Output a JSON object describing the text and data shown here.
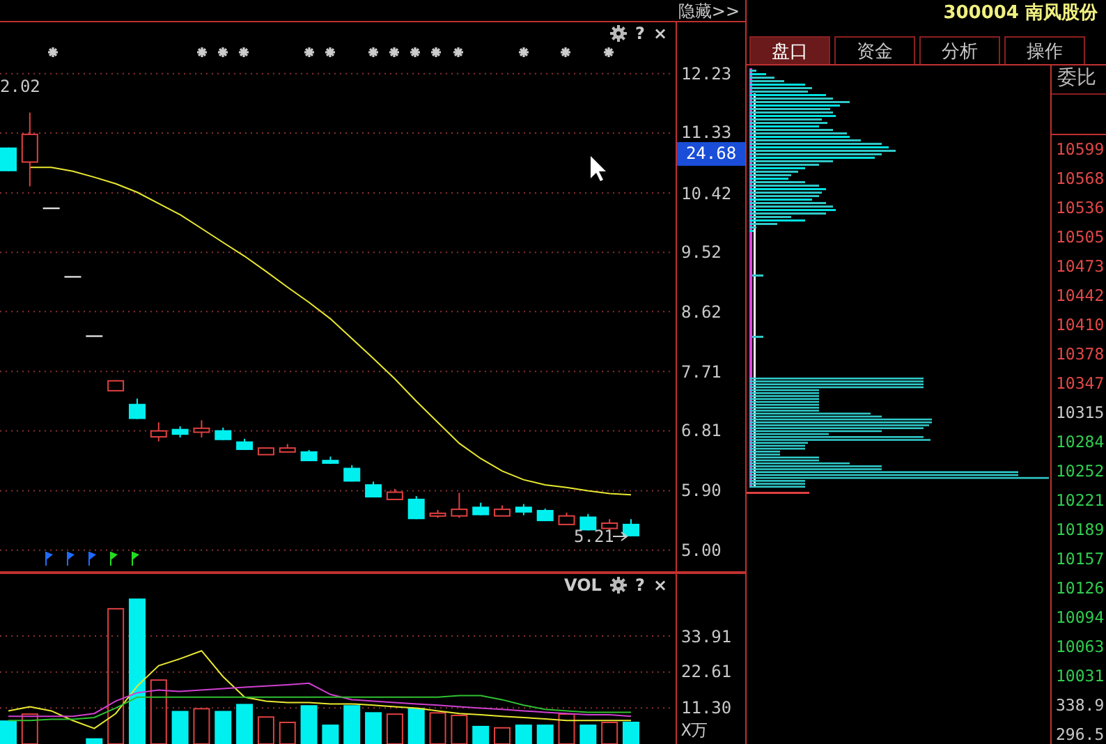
{
  "toolbar": {
    "hide_button": "隐藏>>"
  },
  "price_chart": {
    "help_icon": "?",
    "close_icon": "×",
    "high_label": "2.02",
    "last_label": "5.21",
    "current_price": "24.68",
    "chart_data": {
      "type": "candlestick",
      "ylim": [
        4.68,
        13.01
      ],
      "grid": true,
      "series": [
        {
          "type": "line",
          "color": "#e8e830",
          "values": [
            null,
            10.81,
            10.81,
            10.75,
            10.66,
            10.56,
            10.43,
            10.26,
            10.09,
            9.88,
            9.67,
            9.46,
            9.23,
            8.99,
            8.76,
            8.51,
            8.21,
            7.91,
            7.6,
            7.26,
            6.94,
            6.62,
            6.39,
            6.2,
            6.07,
            5.99,
            5.95,
            5.9,
            5.86,
            5.84
          ]
        }
      ],
      "yticks": [
        {
          "value": 12.23,
          "label": "12.23"
        },
        {
          "value": 11.33,
          "label": "11.33"
        },
        {
          "value": 10.42,
          "label": "10.42"
        },
        {
          "value": 9.52,
          "label": "9.52"
        },
        {
          "value": 8.62,
          "label": "8.62"
        },
        {
          "value": 7.71,
          "label": "7.71"
        },
        {
          "value": 6.81,
          "label": "6.81"
        },
        {
          "value": 5.9,
          "label": "5.90"
        },
        {
          "value": 5.0,
          "label": "5.00"
        }
      ],
      "categories": [
        null,
        null,
        null,
        null,
        null,
        null,
        null,
        null,
        null,
        null,
        null,
        null,
        null,
        null,
        null,
        null,
        null,
        null,
        null,
        null,
        null,
        null,
        null,
        null,
        null,
        null,
        null,
        null,
        null,
        null
      ],
      "ohlc": [
        [
          11.11,
          11.11,
          10.75,
          10.75
        ],
        [
          10.9,
          11.64,
          10.52,
          11.32
        ],
        [
          10.2,
          10.2,
          10.2,
          10.2
        ],
        [
          9.16,
          9.16,
          9.16,
          9.16
        ],
        [
          8.26,
          8.26,
          8.26,
          8.26
        ],
        [
          7.43,
          7.58,
          7.43,
          7.58
        ],
        [
          7.22,
          7.3,
          6.99,
          6.99
        ],
        [
          6.73,
          6.94,
          6.65,
          6.82
        ],
        [
          6.84,
          6.88,
          6.71,
          6.75
        ],
        [
          6.8,
          6.97,
          6.71,
          6.86
        ],
        [
          6.82,
          6.86,
          6.67,
          6.67
        ],
        [
          6.65,
          6.69,
          6.52,
          6.52
        ],
        [
          6.46,
          6.56,
          6.46,
          6.56
        ],
        [
          6.5,
          6.61,
          6.5,
          6.56
        ],
        [
          6.5,
          6.52,
          6.35,
          6.35
        ],
        [
          6.37,
          6.42,
          6.31,
          6.31
        ],
        [
          6.25,
          6.29,
          6.04,
          6.04
        ],
        [
          6.0,
          6.04,
          5.8,
          5.8
        ],
        [
          5.78,
          5.93,
          5.78,
          5.89
        ],
        [
          5.78,
          5.82,
          5.47,
          5.47
        ],
        [
          5.53,
          5.61,
          5.49,
          5.57
        ],
        [
          5.53,
          5.87,
          5.49,
          5.63
        ],
        [
          5.66,
          5.72,
          5.53,
          5.53
        ],
        [
          5.53,
          5.68,
          5.53,
          5.63
        ],
        [
          5.66,
          5.7,
          5.53,
          5.57
        ],
        [
          5.61,
          5.63,
          5.44,
          5.44
        ],
        [
          5.4,
          5.57,
          5.4,
          5.53
        ],
        [
          5.51,
          5.55,
          5.3,
          5.3
        ],
        [
          5.34,
          5.47,
          5.3,
          5.42
        ],
        [
          5.4,
          5.47,
          5.21,
          5.21
        ]
      ]
    },
    "flags": [
      {
        "color": "#1e6cff"
      },
      {
        "color": "#1e6cff"
      },
      {
        "color": "#1e6cff"
      },
      {
        "color": "#22dd22"
      },
      {
        "color": "#22dd22"
      }
    ]
  },
  "volume_chart": {
    "title": "VOL",
    "help_icon": "?",
    "close_icon": "×",
    "unit": "X万",
    "chart_data": {
      "type": "bar",
      "ylim": [
        0,
        53.4
      ],
      "grid": true,
      "yticks": [
        {
          "value": 33.91,
          "label": "33.91"
        },
        {
          "value": 22.61,
          "label": "22.61"
        },
        {
          "value": 11.3,
          "label": "11.30"
        }
      ],
      "categories": [
        null,
        null,
        null,
        null,
        null,
        null,
        null,
        null,
        null,
        null,
        null,
        null,
        null,
        null,
        null,
        null,
        null,
        null,
        null,
        null,
        null,
        null,
        null,
        null,
        null,
        null,
        null,
        null,
        null,
        null
      ],
      "series": [
        {
          "type": "bar",
          "color": "#00f0f0",
          "values": [
            7.4,
            null,
            null,
            null,
            1.8,
            null,
            45.7,
            null,
            10.4,
            null,
            10.4,
            12.6,
            null,
            null,
            12.2,
            6.1,
            12.2,
            10.0,
            null,
            11.3,
            null,
            null,
            5.7,
            null,
            6.1,
            6.1,
            null,
            6.1,
            null,
            7.0
          ]
        },
        {
          "type": "bar",
          "color": "#e04040",
          "values": [
            null,
            9.6,
            null,
            null,
            null,
            42.7,
            null,
            20.3,
            null,
            11.3,
            null,
            null,
            8.7,
            7.0,
            null,
            null,
            null,
            null,
            9.6,
            null,
            10.0,
            9.2,
            null,
            5.3,
            null,
            null,
            9.6,
            null,
            7.0,
            null
          ]
        },
        {
          "type": "line",
          "color": "#e8e830",
          "values": [
            10.4,
            11.7,
            10.4,
            7.4,
            4.9,
            9.6,
            18.2,
            24.6,
            26.8,
            29.3,
            21.2,
            14.7,
            13.5,
            13.0,
            13.0,
            12.6,
            12.6,
            12.2,
            11.7,
            11.3,
            10.4,
            9.6,
            9.2,
            8.7,
            8.3,
            7.9,
            7.4,
            7.4,
            7.4,
            7.4
          ]
        },
        {
          "type": "line",
          "color": "#d040d0",
          "values": [
            8.7,
            8.7,
            8.7,
            8.7,
            9.6,
            13.5,
            16.1,
            17.0,
            16.5,
            17.0,
            17.4,
            17.8,
            18.2,
            18.6,
            19.1,
            15.6,
            13.9,
            13.5,
            13.0,
            12.6,
            12.2,
            11.7,
            11.3,
            10.9,
            10.4,
            10.0,
            9.6,
            9.2,
            9.2,
            8.7
          ]
        },
        {
          "type": "line",
          "color": "#30c030",
          "values": [
            7.4,
            7.4,
            7.8,
            7.8,
            8.3,
            11.3,
            14.7,
            14.7,
            14.7,
            14.7,
            14.7,
            14.7,
            14.7,
            14.7,
            14.7,
            14.7,
            14.7,
            14.7,
            14.7,
            14.7,
            14.7,
            15.2,
            15.2,
            13.9,
            12.2,
            10.9,
            10.4,
            10.0,
            10.0,
            10.0
          ]
        }
      ]
    }
  },
  "stock": {
    "title": "300004 南风股份"
  },
  "tabs": [
    {
      "label": "盘口",
      "selected": true
    },
    {
      "label": "资金",
      "selected": false
    },
    {
      "label": "分析",
      "selected": false
    },
    {
      "label": "操作",
      "selected": false
    }
  ],
  "depth_column": {
    "header": "委比",
    "levels": [
      {
        "label": "10599",
        "color": "#e04848"
      },
      {
        "label": "10568",
        "color": "#e04848"
      },
      {
        "label": "10536",
        "color": "#e04848"
      },
      {
        "label": "10505",
        "color": "#e04848"
      },
      {
        "label": "10473",
        "color": "#e04848"
      },
      {
        "label": "10442",
        "color": "#e04848"
      },
      {
        "label": "10410",
        "color": "#e04848"
      },
      {
        "label": "10378",
        "color": "#e04848"
      },
      {
        "label": "10347",
        "color": "#e04848"
      },
      {
        "label": "10315",
        "color": "#c8c8c8"
      },
      {
        "label": "10284",
        "color": "#30cc50"
      },
      {
        "label": "10252",
        "color": "#30cc50"
      },
      {
        "label": "10221",
        "color": "#30cc50"
      },
      {
        "label": "10189",
        "color": "#30cc50"
      },
      {
        "label": "10157",
        "color": "#30cc50"
      },
      {
        "label": "10126",
        "color": "#30cc50"
      },
      {
        "label": "10094",
        "color": "#30cc50"
      },
      {
        "label": "10063",
        "color": "#30cc50"
      },
      {
        "label": "10031",
        "color": "#30cc50"
      }
    ],
    "totals": [
      "338.9",
      "296.5"
    ]
  }
}
